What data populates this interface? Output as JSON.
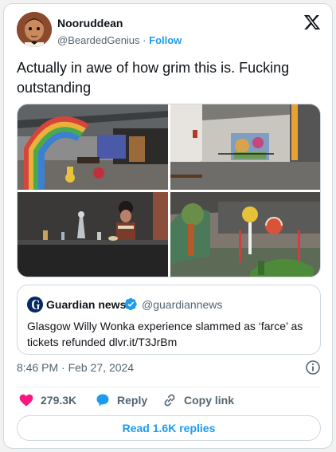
{
  "author": {
    "display_name": "Nooruddean",
    "handle": "@BeardedGenius",
    "separator": "·",
    "follow_label": "Follow"
  },
  "tweet": {
    "text": "Actually in awe of how grim this is. Fucking outstanding"
  },
  "media": {
    "images": [
      {
        "name": "rainbow-arch-warehouse"
      },
      {
        "name": "backdrop-warehouse-room"
      },
      {
        "name": "lab-table-performer"
      },
      {
        "name": "candy-props-scene"
      }
    ]
  },
  "quote": {
    "source_name": "Guardian news",
    "source_handle": "@guardiannews",
    "text": "Glasgow Willy Wonka experience slammed as ‘farce’ as tickets refunded dlvr.it/T3JrBm"
  },
  "timestamp": "8:46 PM · Feb 27, 2024",
  "actions": {
    "likes": "279.3K",
    "reply_label": "Reply",
    "copy_label": "Copy link"
  },
  "read_replies_label": "Read 1.6K replies",
  "colors": {
    "accent": "#1d9bf0",
    "like": "#f91880",
    "text": "#0f1419",
    "secondary": "#536471",
    "border": "#cfd9de"
  }
}
